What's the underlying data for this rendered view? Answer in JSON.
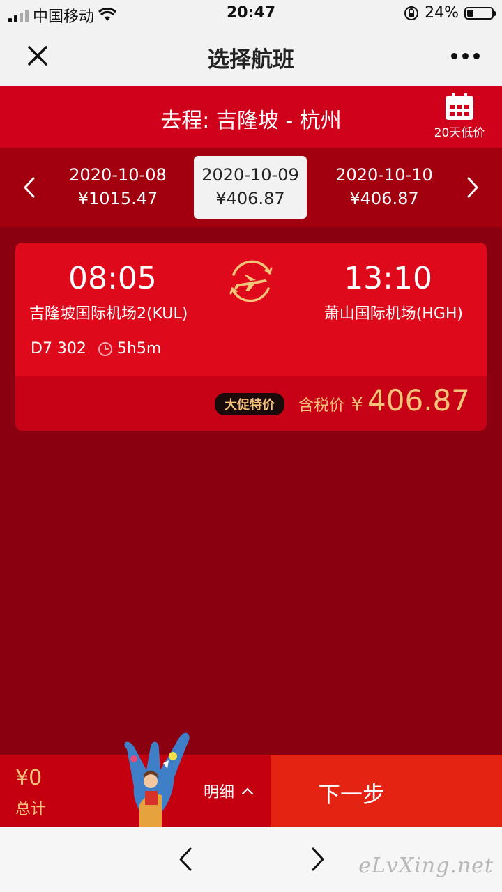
{
  "status": {
    "carrier": "中国移动",
    "time": "20:47",
    "battery": "24%",
    "icons": [
      "signal-icon",
      "wifi-icon",
      "orientation-lock-icon",
      "battery-icon"
    ]
  },
  "nav": {
    "title": "选择航班",
    "close_icon": "close-icon",
    "more_icon": "more-icon"
  },
  "route": {
    "text": "去程: 吉隆坡 - 杭州",
    "calendar_label": "20天低价"
  },
  "dates": [
    {
      "date": "2020-10-08",
      "price": "¥1015.47",
      "selected": false
    },
    {
      "date": "2020-10-09",
      "price": "¥406.87",
      "selected": true
    },
    {
      "date": "2020-10-10",
      "price": "¥406.87",
      "selected": false
    }
  ],
  "flight": {
    "dep_time": "08:05",
    "dep_airport": "吉隆坡国际机场2(KUL)",
    "arr_time": "13:10",
    "arr_airport": "萧山国际机场(HGH)",
    "flight_no": "D7 302",
    "duration": "5h5m",
    "badge": "大促特价",
    "tax_label": "含税价",
    "currency": "¥",
    "price": "406.87"
  },
  "footer": {
    "total": "¥0",
    "total_label": "总计",
    "detail_label": "明细",
    "next_label": "下一步"
  },
  "bottombar": {
    "watermark": "eLvXing.net"
  },
  "colors": {
    "brand_red": "#d0021b",
    "page_bg": "#8b0011",
    "accent_gold": "#f6c37a",
    "next_button": "#e42312"
  }
}
